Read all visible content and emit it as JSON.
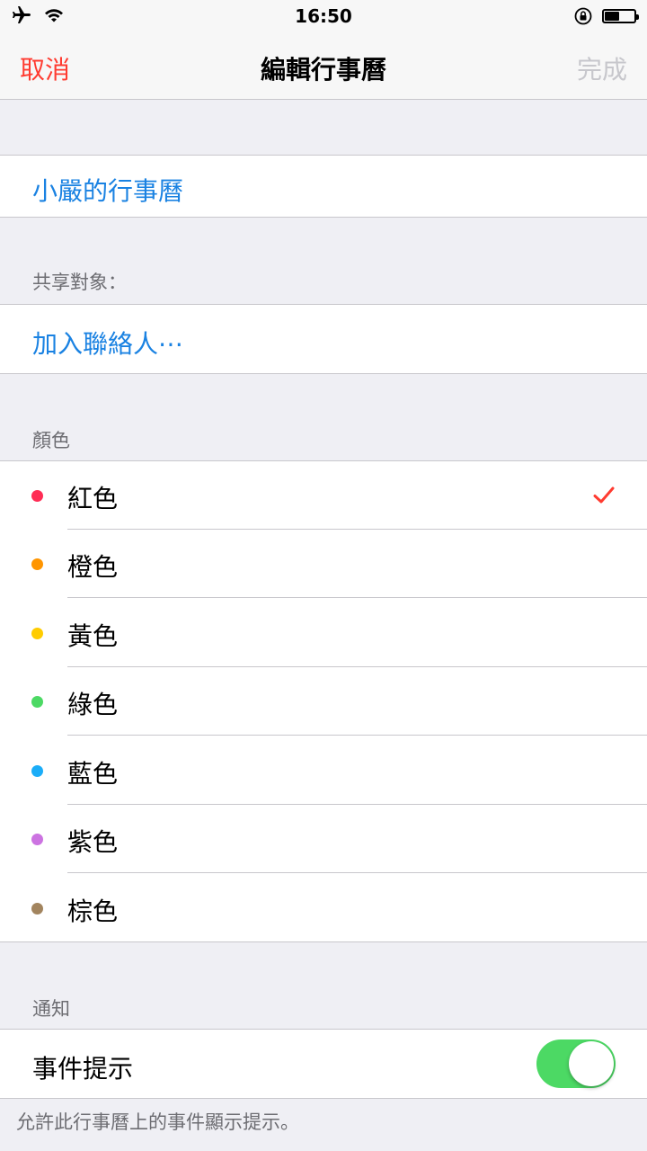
{
  "status_bar": {
    "time": "16:50",
    "airplane_icon": "airplane-icon",
    "wifi_icon": "wifi-icon",
    "rotation_lock_icon": "rotation-lock-icon",
    "battery_level": 0.5
  },
  "nav": {
    "cancel_label": "取消",
    "title": "編輯行事曆",
    "done_label": "完成",
    "cancel_color": "#ff3b30",
    "done_color": "#c7c7cc"
  },
  "calendar_name": {
    "value": "小嚴的行事曆"
  },
  "sharing": {
    "header": "共享對象：",
    "add_contact_label": "加入聯絡人⋯"
  },
  "colors": {
    "header": "顏色",
    "selected_index": 0,
    "items": [
      {
        "label": "紅色",
        "color": "#ff2d55"
      },
      {
        "label": "橙色",
        "color": "#ff9500"
      },
      {
        "label": "黃色",
        "color": "#ffcc00"
      },
      {
        "label": "綠色",
        "color": "#4cd964"
      },
      {
        "label": "藍色",
        "color": "#1badf8"
      },
      {
        "label": "紫色",
        "color": "#cc73e1"
      },
      {
        "label": "棕色",
        "color": "#a2845e"
      }
    ],
    "check_color": "#ff3b30"
  },
  "notifications": {
    "header": "通知",
    "event_alert_label": "事件提示",
    "event_alert_on": true,
    "footer": "允許此行事曆上的事件顯示提示。"
  },
  "accent_color": "#1a82e2"
}
